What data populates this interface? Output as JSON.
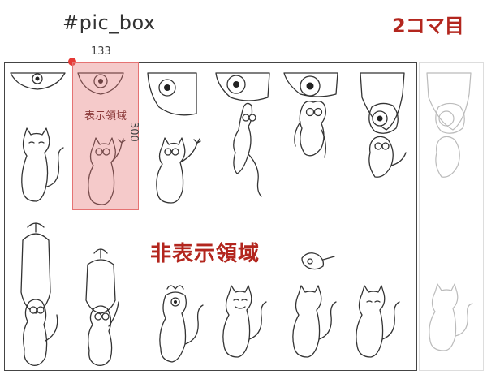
{
  "title": "#pic_box",
  "frame_label": "2コマ目",
  "visible_width": "133",
  "visible_height": "300",
  "visible_area_label": "表示領域",
  "hidden_area_label": "非表示領域"
}
